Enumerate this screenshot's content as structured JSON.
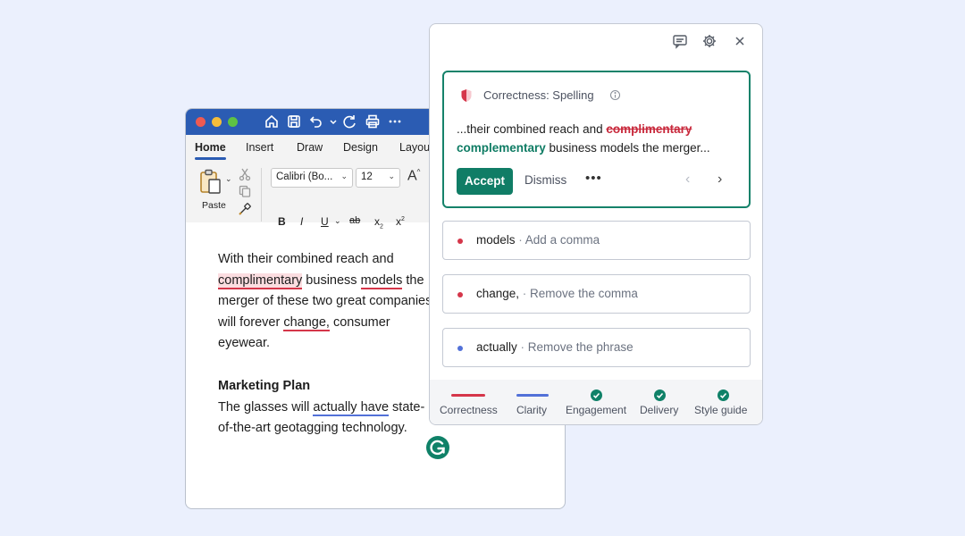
{
  "word": {
    "tabs": [
      "Home",
      "Insert",
      "Draw",
      "Design",
      "Layou"
    ],
    "paste_label": "Paste",
    "font_name": "Calibri (Bo...",
    "font_size": "12",
    "grow_font": "A",
    "format": {
      "bold": "B",
      "italic": "I",
      "underline": "U",
      "strike": "ab",
      "subscript": "x",
      "superscript": "x"
    },
    "doc": {
      "p1_a": "With their combined reach and",
      "p1_misspelled": "complimentary",
      "p1_b": " business ",
      "p1_models": "models",
      "p1_c": "the merger of these two great companies will forever ",
      "p1_change": "change,",
      "p1_d": "consumer eyewear.",
      "heading": "Marketing Plan",
      "p2_a": "The glasses will ",
      "p2_phrase": "actually have",
      "p2_b": "state-of-the-art geotagging technology."
    }
  },
  "panel": {
    "main_card": {
      "category": "Correctness: Spelling",
      "text_before": "...their combined reach and ",
      "wrong": "complimentary",
      "correct": "complementary",
      "text_after": " business models the merger...",
      "accept": "Accept",
      "dismiss": "Dismiss",
      "more": "•••"
    },
    "cards": [
      {
        "word": "models",
        "hint": "Add a comma",
        "color": "#d5364a"
      },
      {
        "word": "change,",
        "hint": "Remove the comma",
        "color": "#d5364a"
      },
      {
        "word": "actually",
        "hint": "Remove the phrase",
        "color": "#5271d8"
      }
    ],
    "footer": [
      {
        "label": "Correctness",
        "state": "bar",
        "color": "#d5364a"
      },
      {
        "label": "Clarity",
        "state": "bar",
        "color": "#5271d8"
      },
      {
        "label": "Engagement",
        "state": "done",
        "color": "#0f8168"
      },
      {
        "label": "Delivery",
        "state": "done",
        "color": "#0f8168"
      },
      {
        "label": "Style guide",
        "state": "done",
        "color": "#0f8168"
      }
    ]
  },
  "sep": " · "
}
